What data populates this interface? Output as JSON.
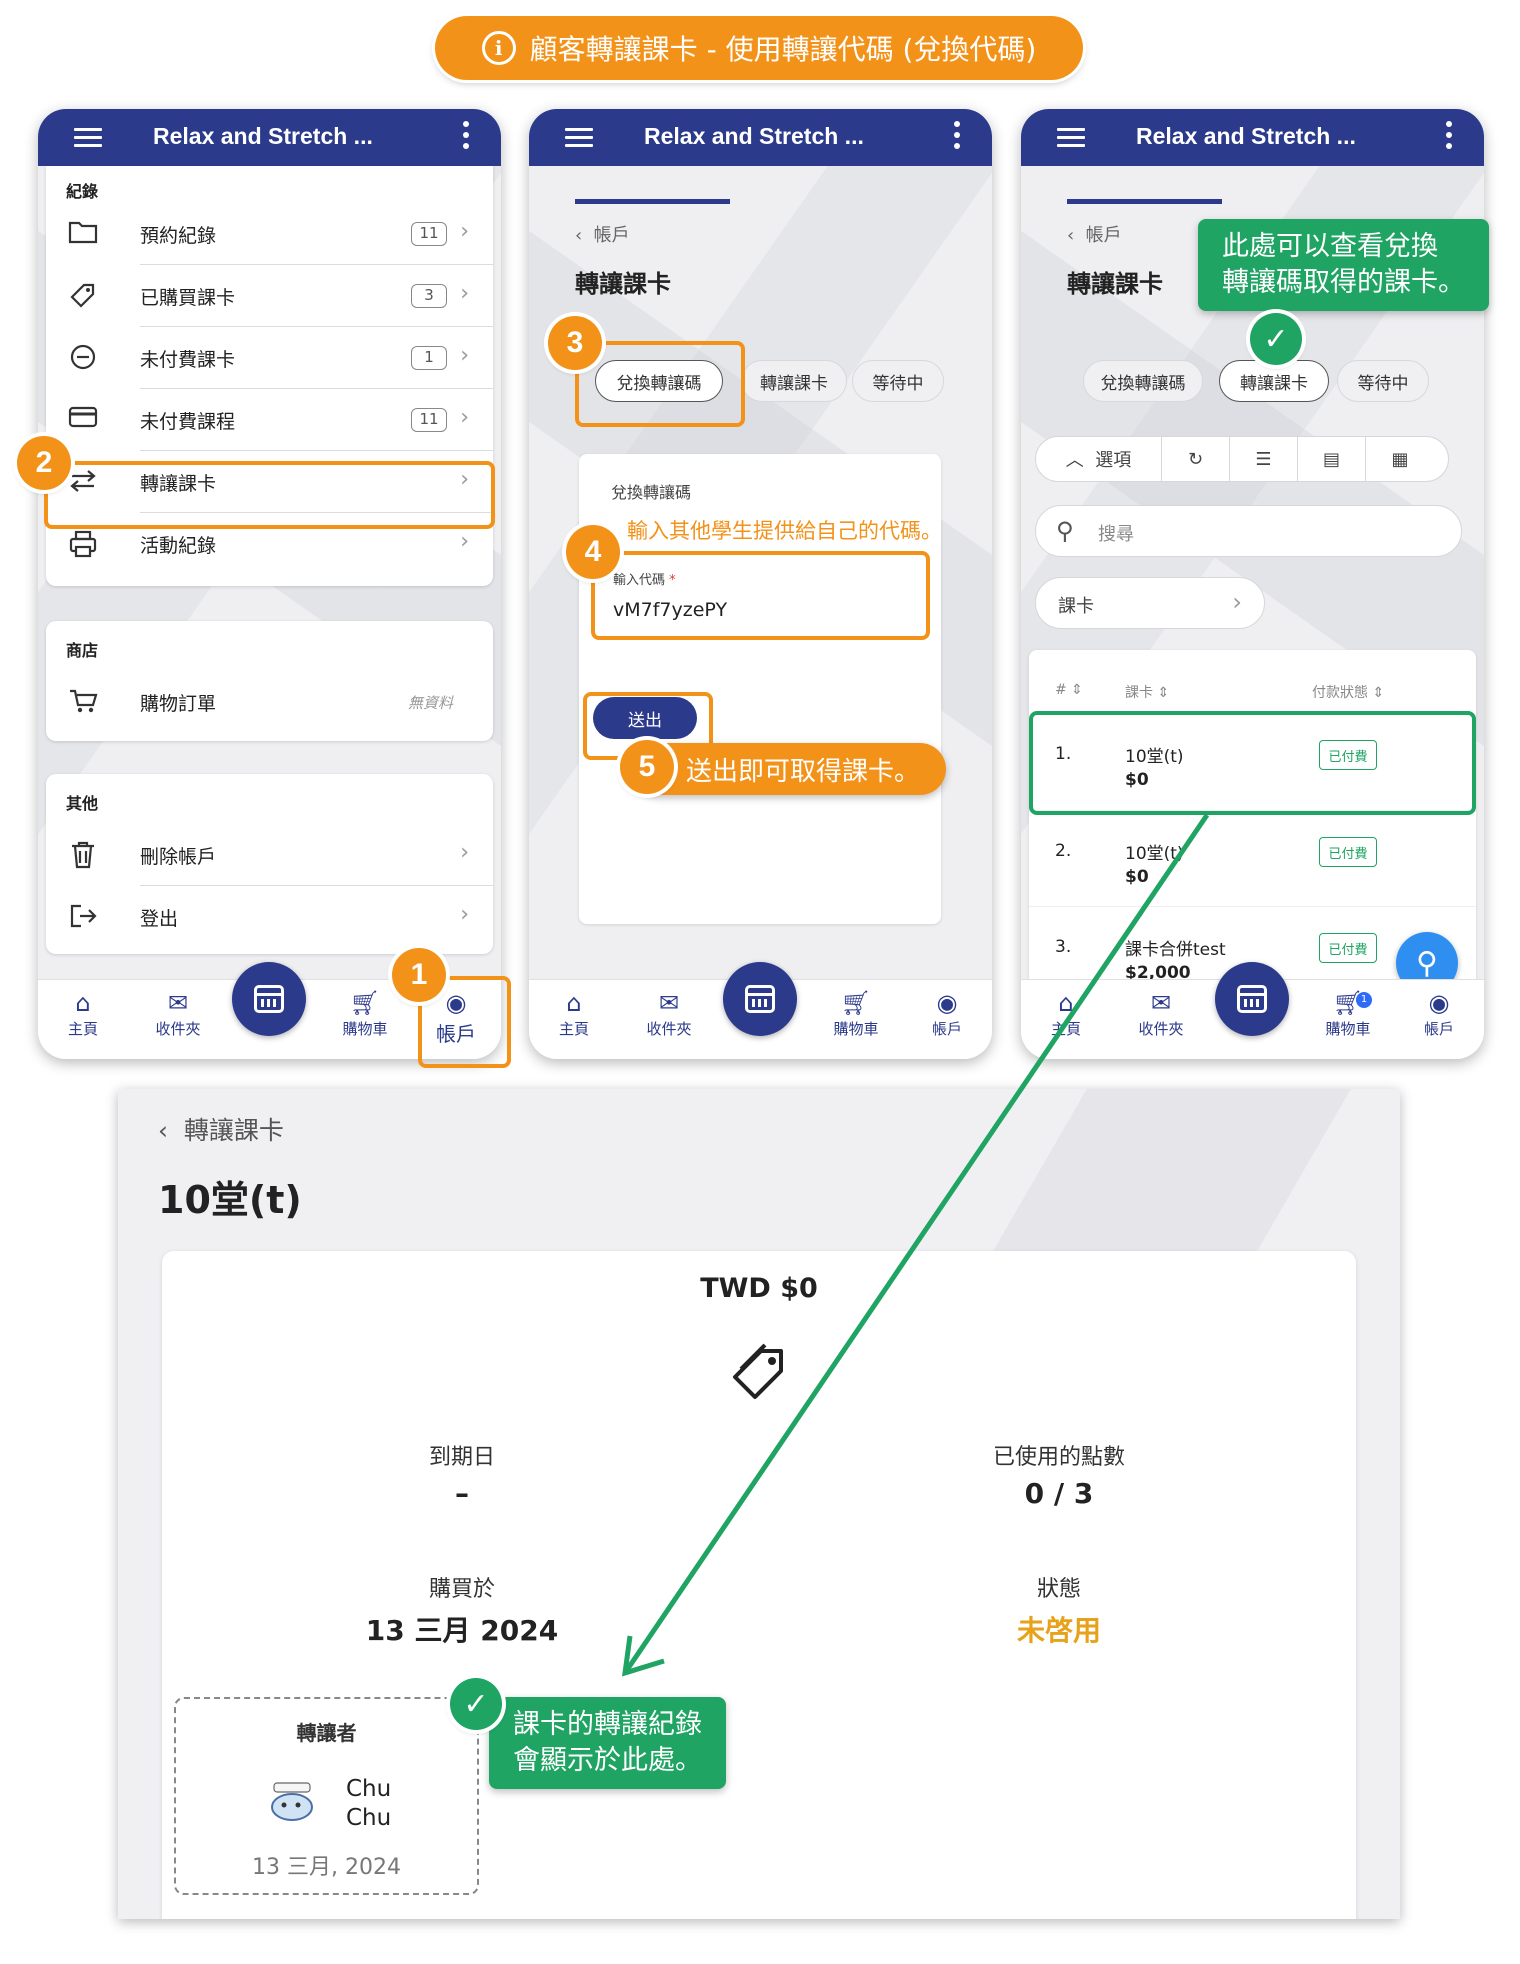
{
  "banner": {
    "text": "顧客轉讓課卡 - 使用轉讓代碼 (兌換代碼)"
  },
  "app": {
    "title": "Relax and Stretch ..."
  },
  "nav": {
    "home": "主頁",
    "inbox": "收件夾",
    "cart": "購物車",
    "account": "帳戶"
  },
  "phone1": {
    "records_title": "紀錄",
    "records": [
      {
        "label": "預約紀錄",
        "count": "11",
        "icon": "folder-icon"
      },
      {
        "label": "已購買課卡",
        "count": "3",
        "icon": "tag-icon"
      },
      {
        "label": "未付費課卡",
        "count": "1",
        "icon": "minus-circle-icon"
      },
      {
        "label": "未付費課程",
        "count": "11",
        "icon": "credit-card-icon"
      },
      {
        "label": "轉讓課卡",
        "count": "",
        "icon": "transfer-icon"
      },
      {
        "label": "活動紀錄",
        "count": "",
        "icon": "printer-icon"
      }
    ],
    "shop_title": "商店",
    "shop_row": {
      "label": "購物訂單",
      "empty": "無資料"
    },
    "other_title": "其他",
    "other_rows": [
      {
        "label": "刪除帳戶",
        "icon": "trash-icon"
      },
      {
        "label": "登出",
        "icon": "logout-icon"
      }
    ]
  },
  "phone2": {
    "back": "帳戶",
    "heading": "轉讓課卡",
    "tabs": [
      "兌換轉讓碼",
      "轉讓課卡",
      "等待中"
    ],
    "form_title": "兌換轉讓碼",
    "hint": "輸入其他學生提供給自己的代碼。",
    "field_label": "輸入代碼",
    "required_mark": "*",
    "field_value": "vM7f7yzePY",
    "submit": "送出",
    "note": "送出即可取得課卡。"
  },
  "phone3": {
    "back": "帳戶",
    "heading": "轉讓課卡",
    "tabs": [
      "兌換轉讓碼",
      "轉讓課卡",
      "等待中"
    ],
    "callout": [
      "此處可以查看兌換",
      "轉讓碼取得的課卡。"
    ],
    "options": "選項",
    "search_placeholder": "搜尋",
    "filter": "課卡",
    "columns": [
      "#",
      "課卡",
      "付款狀態"
    ],
    "rows": [
      {
        "idx": "1.",
        "name": "10堂(t)",
        "price": "$0",
        "status": "已付費"
      },
      {
        "idx": "2.",
        "name": "10堂(t)",
        "price": "$0",
        "status": "已付費"
      },
      {
        "idx": "3.",
        "name": "課卡合併test",
        "price": "$2,000",
        "status": "已付費"
      }
    ],
    "cart_badge": "1"
  },
  "steps": [
    "1",
    "2",
    "3",
    "4",
    "5"
  ],
  "detail": {
    "back": "轉讓課卡",
    "title": "10堂(t)",
    "price": "TWD $0",
    "expiry_label": "到期日",
    "expiry_value": "–",
    "points_label": "已使用的點數",
    "points_value": "0 / 3",
    "bought_label": "購買於",
    "bought_value": "13 三月 2024",
    "status_label": "狀態",
    "status_value": "未啓用",
    "transfer_label": "轉讓者",
    "transfer_name_1": "Chu",
    "transfer_name_2": "Chu",
    "transfer_date": "13 三月, 2024",
    "callout": [
      "課卡的轉讓紀錄",
      "會顯示於此處。"
    ]
  },
  "colors": {
    "primary": "#2c3a8c",
    "accent": "#f39219",
    "success": "#1fa463"
  }
}
